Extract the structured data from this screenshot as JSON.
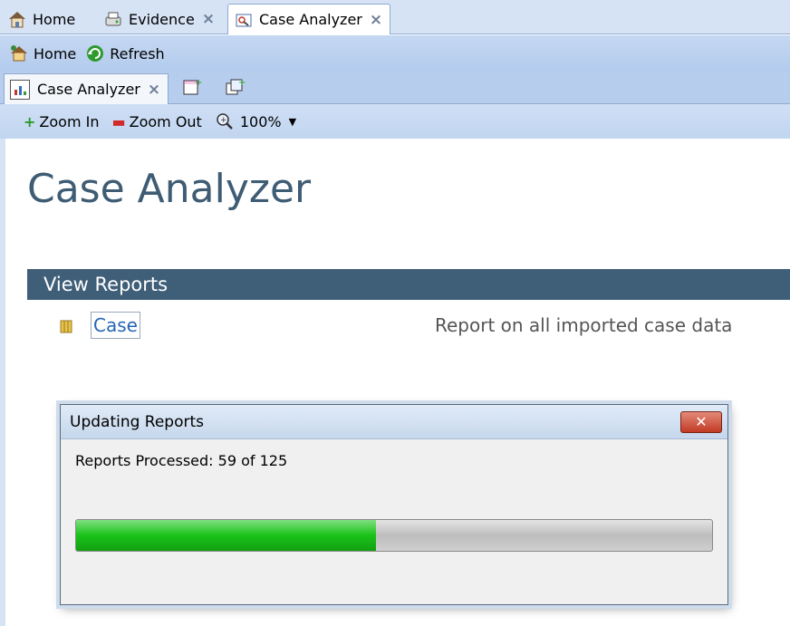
{
  "tabs": [
    {
      "label": "Home",
      "icon": "home-icon",
      "closable": false,
      "active": false
    },
    {
      "label": "Evidence",
      "icon": "evidence-icon",
      "closable": true,
      "active": false
    },
    {
      "label": "Case Analyzer",
      "icon": "case-analyzer-icon",
      "closable": true,
      "active": true
    }
  ],
  "toolbar": {
    "home_label": "Home",
    "refresh_label": "Refresh"
  },
  "inner_tabs": [
    {
      "label": "Case Analyzer",
      "icon": "report-icon",
      "closable": true
    }
  ],
  "zoombar": {
    "zoom_in_label": "Zoom In",
    "zoom_out_label": "Zoom Out",
    "zoom_level": "100%"
  },
  "page": {
    "title": "Case Analyzer",
    "section_header": "View Reports",
    "reports": [
      {
        "name": "Case",
        "description": "Report on all imported case data",
        "icon": "folder-icon"
      }
    ]
  },
  "dialog": {
    "title": "Updating Reports",
    "close_label": "✕",
    "status": "Reports Processed: 59 of 125",
    "progress_fraction": 0.472
  },
  "colors": {
    "accent": "#3f5e78",
    "title_text": "#3e5c74",
    "link": "#2566b4",
    "progress_green": "#19c219"
  }
}
